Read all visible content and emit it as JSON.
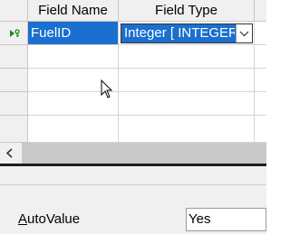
{
  "table": {
    "columns": [
      {
        "label": "Field Name"
      },
      {
        "label": "Field Type"
      }
    ],
    "rows": [
      {
        "field_name": "FuelID",
        "field_type": "Integer [ INTEGER ]",
        "primary_key": true,
        "selected": true
      },
      {
        "field_name": "",
        "field_type": ""
      },
      {
        "field_name": "",
        "field_type": ""
      },
      {
        "field_name": "",
        "field_type": ""
      },
      {
        "field_name": "",
        "field_type": ""
      }
    ]
  },
  "field_type_combo": {
    "value": "Integer [ INTEGER ]"
  },
  "scrollbar": {
    "left_arrow": "<"
  },
  "properties": {
    "autovalue_label": "AutoValue",
    "autovalue_accel": "A",
    "autovalue_rest": "utoValue",
    "autovalue_value": "Yes"
  },
  "colors": {
    "selection": "#1a6fcf",
    "header": "#f0f0f0"
  }
}
